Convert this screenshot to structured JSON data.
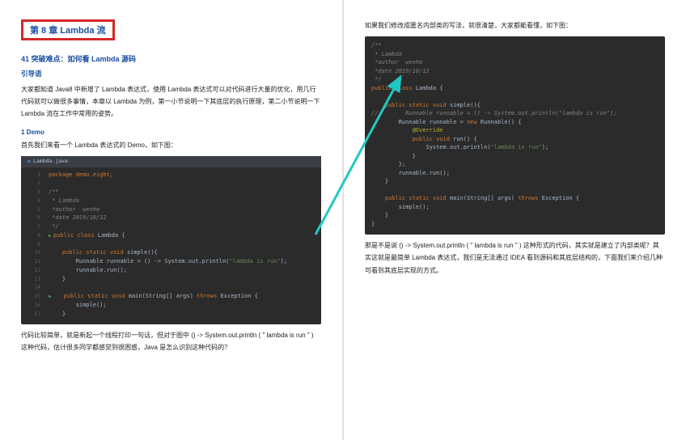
{
  "left": {
    "chapter_title": "第 8 章 Lambda 流",
    "section_title": "41 突破难点：如何看 Lambda 源码",
    "intro_label": "引导语",
    "intro_text": "大家都知道 Java8 中新增了 Lambda 表达式，使用 Lambda 表达式可以对代码进行大量的优化，用几行代码就可以做很多事情，本章以 Lambda 为例，第一小节说明一下其底层的执行原理，第二小节说明一下 Lambda 流在工作中常用的姿势。",
    "demo_label": "1 Demo",
    "demo_intro": "首先我们来看一个 Lambda 表达式的 Demo，如下图：",
    "tab_name": "Lambda.java",
    "demo_outro": "代码比较简单，就是新起一个线程打印一句话，但对于图中 () -> System.out.println ( \" lambda is run \" ) 这种代码，估计很多同学都感觉到很困惑，Java 是怎么识别这种代码的？"
  },
  "right": {
    "top_text": "如果我们修改成匿名内部类的写法，就很清楚，大家都能看懂，如下图：",
    "outro_text": "那是不是说 () -> System.out.println ( \" lambda is run \" ) 这种形式的代码，其实就是建立了内部类呢？其实这就是最简单 Lambda 表达式，我们是无法通过 IDEA 看到源码和其底层结构的，下面我们来介绍几种可看到其底层实现的方式。"
  },
  "code_left": {
    "l1": "package demo.eight;",
    "l3": "/**",
    "l4": " * Lambda",
    "l5": " *author  wenhe",
    "l6": " *date 2019/10/12",
    "l7": " */",
    "l8": "public class Lambda {",
    "l10a": "public static void simple(){",
    "l11a": "Runnable runnable = () -> System.out.println(\"lambda is run\");",
    "l12": "runnable.run();",
    "l13": "}",
    "l15a": "public static void main(String[] args)",
    "l15b": " throws Exception {",
    "l16": "simple();",
    "l17": "}"
  },
  "code_right": {
    "l1": "/**",
    "l2": " * Lambda",
    "l3": " *author  wenhe",
    "l4": " *date 2019/10/12",
    "l5": " */",
    "l6a": "public class Lambda {",
    "l8a": "public static void simple(){",
    "l9c": "//        Runnable runnable = () -> System.out.println(\"lambda is run\");",
    "l10a": "Runnable runnable = ",
    "l10b": "new Runnable() {",
    "l11": "@Override",
    "l12a": "public void run() {",
    "l13a": "System.out.println(",
    "l13b": "\"lambda is run\");",
    "l14": "}",
    "l15": "};",
    "l16": "runnable.run();",
    "l17": "}",
    "l19a": "public static void main(String[] args)",
    "l19b": " throws Exception {",
    "l20": "simple();",
    "l21": "}",
    "l22": "}"
  }
}
